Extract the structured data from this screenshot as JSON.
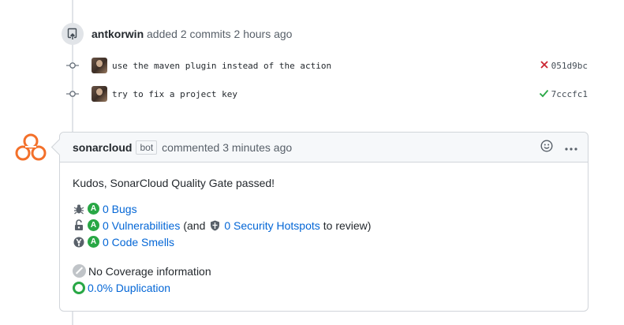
{
  "event": {
    "actor": "antkorwin",
    "action": "added 2 commits 2 hours ago",
    "icon": "repo-push-icon"
  },
  "commits": [
    {
      "message": "use the maven plugin instead of the action",
      "status": "failure",
      "status_color": "#cb2431",
      "sha": "051d9bc"
    },
    {
      "message": "try to fix a project key",
      "status": "success",
      "status_color": "#28a745",
      "sha": "7cccfc1"
    }
  ],
  "comment": {
    "author": "sonarcloud",
    "bot_label": "bot",
    "meta": "commented 3 minutes ago",
    "brand_color": "#f3702a",
    "intro": "Kudos, SonarCloud Quality Gate passed!",
    "metrics": [
      {
        "icon": "bug-icon",
        "grade": "A",
        "link": "0 Bugs"
      },
      {
        "icon": "unlock-icon",
        "grade": "A",
        "link": "0 Vulnerabilities",
        "pre": "(and",
        "hotspot_icon": "shield-icon",
        "link2": "0 Security Hotspots",
        "post": "to review)"
      },
      {
        "icon": "code-smell-icon",
        "grade": "A",
        "link": "0 Code Smells"
      }
    ],
    "coverage": {
      "icon": "no-coverage-icon",
      "text": "No Coverage information"
    },
    "duplication": {
      "icon": "duplication-ring-icon",
      "link": "0.0% Duplication"
    },
    "grade_color": "#28a745",
    "link_color": "#0366d6"
  }
}
